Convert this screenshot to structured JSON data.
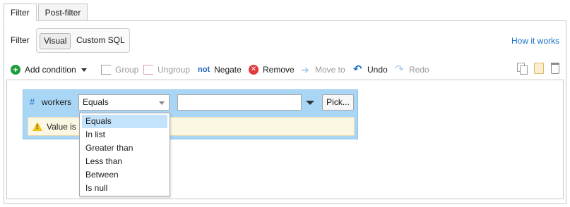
{
  "tabs": [
    {
      "label": "Filter",
      "active": true
    },
    {
      "label": "Post-filter",
      "active": false
    }
  ],
  "filter_mode": {
    "label": "Filter",
    "options": [
      "Visual",
      "Custom SQL"
    ],
    "selected": "Visual",
    "help_link": "How it works"
  },
  "toolbar": {
    "add_condition": "Add condition",
    "group": "Group",
    "ungroup": "Ungroup",
    "not_icon_text": "not",
    "negate": "Negate",
    "remove": "Remove",
    "move_to": "Move to",
    "undo": "Undo",
    "redo": "Redo"
  },
  "condition": {
    "type_symbol": "#",
    "column": "workers",
    "operator": "Equals",
    "value": "",
    "pick_button": "Pick...",
    "warning": "Value is r"
  },
  "operator_dropdown": {
    "options": [
      "Equals",
      "In list",
      "Greater than",
      "Less than",
      "Between",
      "Is null"
    ],
    "selected_index": 0
  },
  "colors": {
    "condition_bg": "#a9d6f5",
    "accent": "#1b6fc4",
    "add_green": "#1f9d3d",
    "remove_red": "#e0393e",
    "warning_bg": "#fbf7e3",
    "dropdown_selected": "#c3e2fb"
  }
}
